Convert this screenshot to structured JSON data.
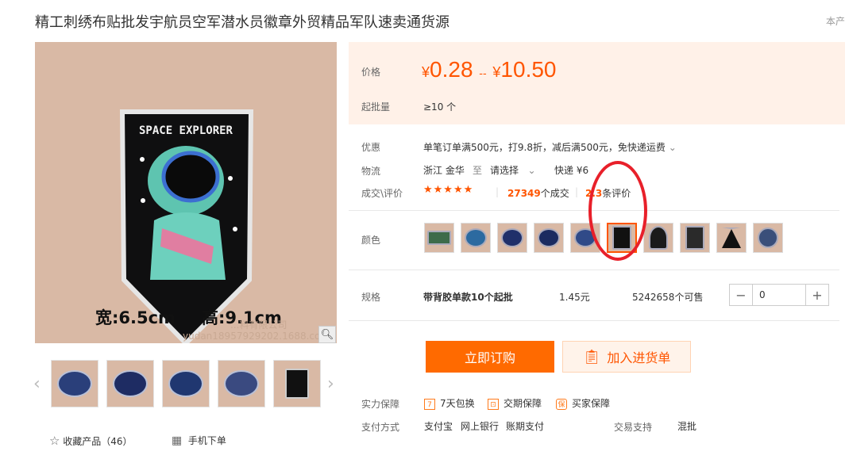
{
  "title": "精工刺绣布贴批发宇航员空军潜水员徽章外贸精品军队速卖通货源",
  "top_right": "本产",
  "main_image": {
    "patch_text": "SPACE EXPLORER",
    "width_label": "宽:6.5cm",
    "height_label": "高:9.1cm",
    "watermark_line1": "...料有限公司",
    "watermark_line2": "yudan18957929202.1688.co"
  },
  "favorite": {
    "icon": "star-icon",
    "label": "收藏产品（46）"
  },
  "mobile_order": {
    "icon": "qrcode-icon",
    "label": "手机下单"
  },
  "price": {
    "label": "价格",
    "currency": "¥",
    "low": "0.28",
    "sep": "--",
    "high": "10.50",
    "min_label": "起批量",
    "min_value": "≥10 个"
  },
  "promo": {
    "label": "优惠",
    "value": "单笔订单满500元，打9.8折，减后满500元，免快递运费"
  },
  "logistics": {
    "label": "物流",
    "from": "浙江 金华",
    "to_word": "至",
    "select": "请选择",
    "shipping": "快递 ¥6"
  },
  "deals": {
    "label": "成交\\评价",
    "stars": "★★★★★",
    "count": "27349",
    "count_suffix": "个成交",
    "reviews": "2.3",
    "reviews_suffix": "条评价"
  },
  "color": {
    "label": "颜色",
    "selected_index": 5
  },
  "spec": {
    "label": "规格",
    "name": "带背胶单款10个起批",
    "price": "1.45元",
    "stock": "5242658个可售",
    "qty": "0"
  },
  "buttons": {
    "buy": "立即订购",
    "cart": "加入进货单"
  },
  "guarantee": {
    "label": "实力保障",
    "items": [
      "7天包换",
      "交期保障",
      "买家保障"
    ],
    "icons": [
      "7",
      "⊡",
      "保"
    ]
  },
  "payment": {
    "label": "支付方式",
    "methods": [
      "支付宝",
      "网上银行",
      "账期支付"
    ],
    "trade_label": "交易支持",
    "trade_value": "混批"
  },
  "colors": {
    "accent": "#ff5500",
    "price_bg": "#fff1e8",
    "annotation": "#e8202a"
  }
}
